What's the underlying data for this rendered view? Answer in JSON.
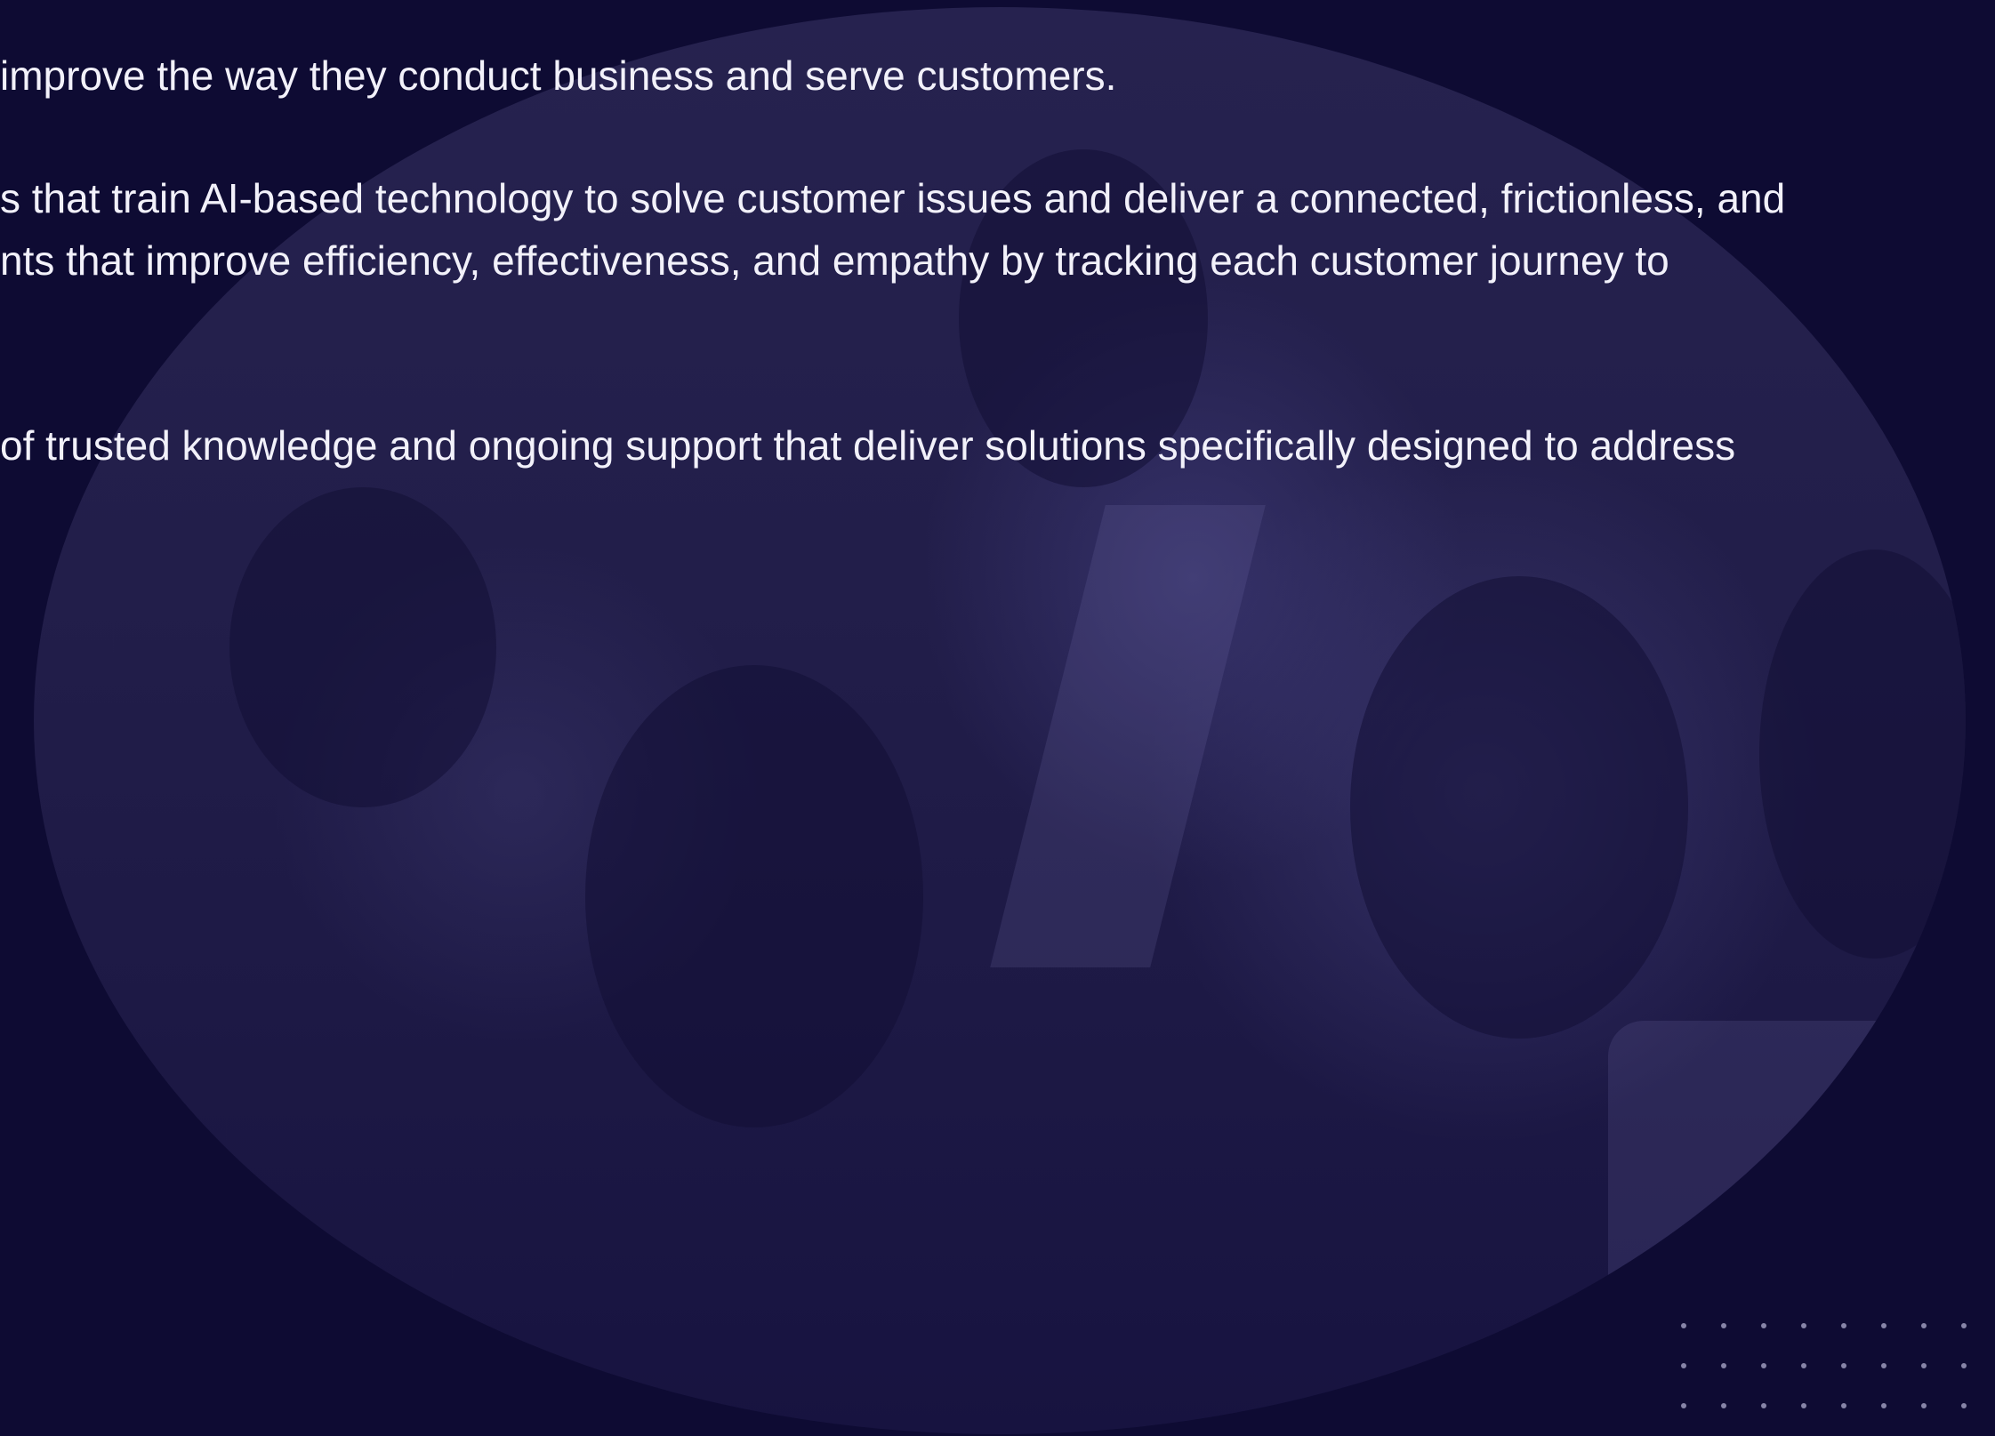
{
  "paragraphs": [
    {
      "lines": [
        "improve the way they conduct business and serve customers."
      ]
    },
    {
      "lines": [
        "s that train AI-based technology to solve customer issues and deliver a connected, frictionless, and",
        "nts that improve efficiency, effectiveness, and empathy by tracking each customer journey to"
      ]
    },
    {
      "lines": [
        "of trusted knowledge and ongoing support that deliver solutions specifically designed to address"
      ]
    }
  ],
  "decor": {
    "background_color": "#0e0b33",
    "overlay_color": "#26224f",
    "dot_grid_rows": 3,
    "dot_grid_cols": 8
  }
}
